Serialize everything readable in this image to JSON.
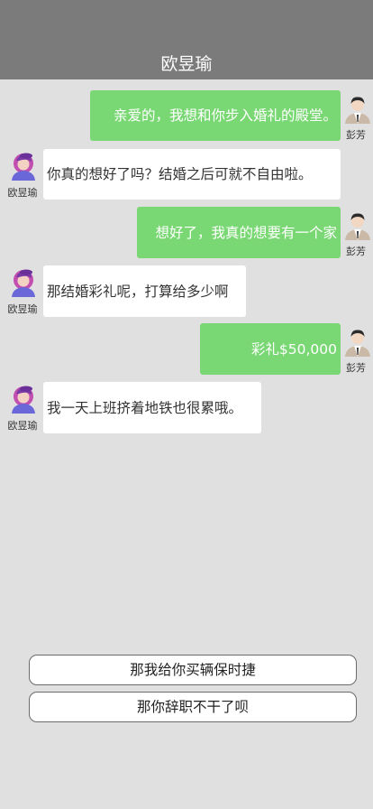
{
  "header": {
    "title": "欧昱瑜"
  },
  "messages": [
    {
      "side": "me",
      "name": "彭芳",
      "text": "亲爱的，我想和你步入婚礼的殿堂。"
    },
    {
      "side": "other",
      "name": "欧昱瑜",
      "text": "你真的想好了吗？结婚之后可就不自由啦。"
    },
    {
      "side": "me",
      "name": "彭芳",
      "text": "想好了，我真的想要有一个家"
    },
    {
      "side": "other",
      "name": "欧昱瑜",
      "text": "那结婚彩礼呢，打算给多少啊"
    },
    {
      "side": "me",
      "name": "彭芳",
      "text": "彩礼$50,000"
    },
    {
      "side": "other",
      "name": "欧昱瑜",
      "text": "我一天上班挤着地铁也很累哦。"
    }
  ],
  "choices": [
    {
      "label": "那我给你买辆保时捷"
    },
    {
      "label": "那你辞职不干了呗"
    }
  ],
  "colors": {
    "header": "#7b7b7b",
    "bg": "#e0e0e0",
    "me_bubble": "#79d873",
    "other_bubble": "#ffffff"
  },
  "icons": {
    "me_avatar": "man-in-suit-avatar-icon",
    "other_avatar": "woman-purple-hair-avatar-icon"
  }
}
